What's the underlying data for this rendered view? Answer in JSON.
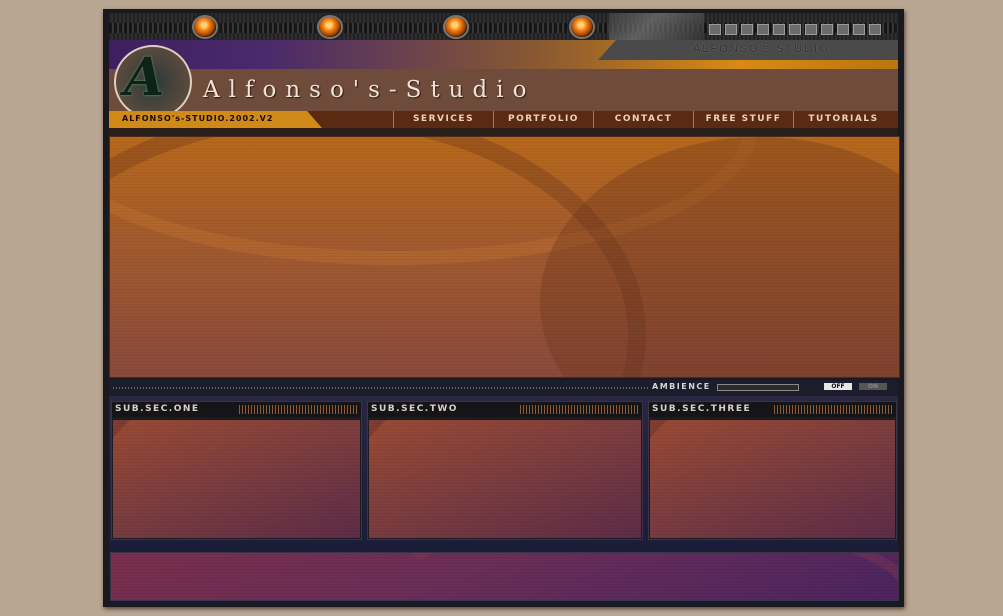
{
  "site": {
    "title": "Alfonso's-Studio",
    "logo_letter": "A",
    "header_strip_text": "ALFONSO's STUDIO",
    "version_text": "ALFONSO's-STUDIO.2002.V2"
  },
  "nav": {
    "items": [
      {
        "label": "SERVICES"
      },
      {
        "label": "PORTFOLIO"
      },
      {
        "label": "CONTACT"
      },
      {
        "label": "FREE STUFF"
      },
      {
        "label": "TUTORIALS"
      }
    ]
  },
  "ambience": {
    "label": "AMBIENCE",
    "off_label": "OFF",
    "on_label": "ON",
    "state": "off"
  },
  "subsections": [
    {
      "title": "SUB.SEC.ONE"
    },
    {
      "title": "SUB.SEC.TWO"
    },
    {
      "title": "SUB.SEC.THREE"
    }
  ],
  "colors": {
    "page_bg": "#b8a592",
    "accent_orange": "#d08a18",
    "nav_bg": "#5a2a12",
    "band_purple": "#3d1f5f"
  },
  "icons": {
    "top_lights": "orange-light-icon",
    "logo": "alfonso-logo-icon"
  }
}
